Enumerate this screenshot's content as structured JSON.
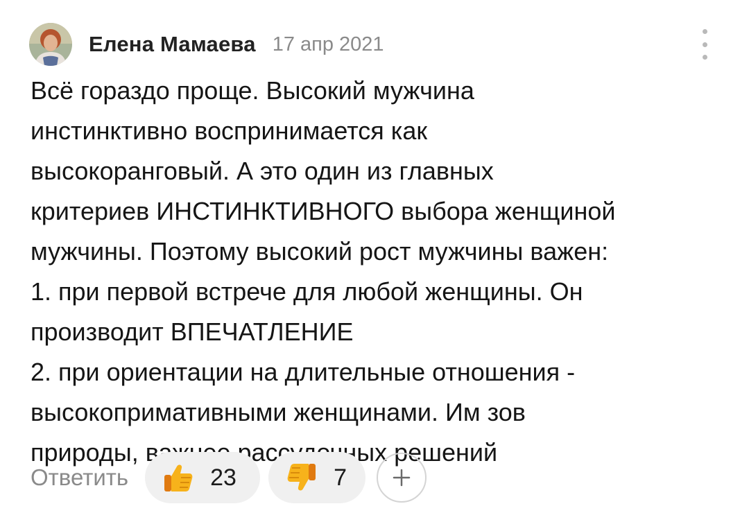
{
  "comment": {
    "author": "Елена Мамаева",
    "date": "17 апр 2021",
    "text_lines": [
      "Всё гораздо проще. Высокий мужчина",
      "инстинктивно воспринимается как",
      "высокоранговый. А это один из главных",
      "критериев ИНСТИНКТИВНОГО выбора женщиной",
      "мужчины. Поэтому высокий рост мужчины важен:",
      "1. при первой встрече для любой женщины. Он",
      "производит ВПЕЧАТЛЕНИЕ",
      "2. при ориентации на длительные отношения -",
      "высокопримативными женщинами. Им зов",
      "природы, важнее рассудочных решений"
    ]
  },
  "actions": {
    "reply_label": "Ответить",
    "likes_count": "23",
    "dislikes_count": "7",
    "like_icon": "thumbs-up-icon",
    "dislike_icon": "thumbs-down-icon",
    "add_icon": "plus-icon"
  },
  "colors": {
    "muted": "#8a8a8a",
    "pill_bg": "#f0f0f0",
    "emoji_yellow": "#f7b21b"
  }
}
